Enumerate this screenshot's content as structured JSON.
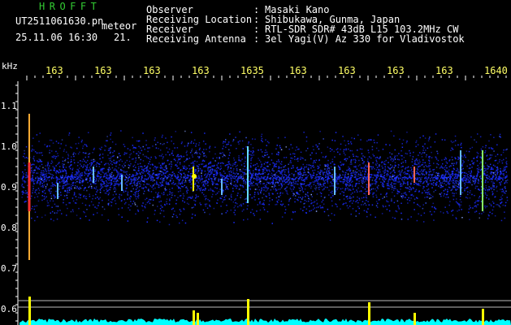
{
  "header": {
    "brand": "HROFFT",
    "filename": "UT2511061630.pn",
    "tag": "meteor",
    "datetime": "25.11.06 16:30",
    "count": "21."
  },
  "info": [
    {
      "label": "Observer",
      "value": "Masaki Kano"
    },
    {
      "label": "Receiving Location",
      "value": "Shibukawa, Gunma, Japan"
    },
    {
      "label": "Receiver",
      "value": "RTL-SDR SDR# 43dB L15 103.2MHz CW"
    },
    {
      "label": "Receiving Antenna",
      "value": "3el Yagi(V) Az 330 for Vladivostok"
    }
  ],
  "axes": {
    "y_unit": "kHz",
    "y_ticks": [
      "1.1",
      "1.0",
      "0.9",
      "0.8",
      "0.7",
      "0.6"
    ],
    "time_ticks": [
      "163",
      "163",
      "163",
      "163",
      "1635",
      "163",
      "163",
      "163",
      "163",
      "1640"
    ]
  },
  "colors": {
    "background": "#000000",
    "noise": "#1a2cff",
    "signal_warm": "#ff3030",
    "signal_hot": "#ffff00",
    "bottom_level": "#00ffff",
    "tick_text": "#ffff66"
  }
}
